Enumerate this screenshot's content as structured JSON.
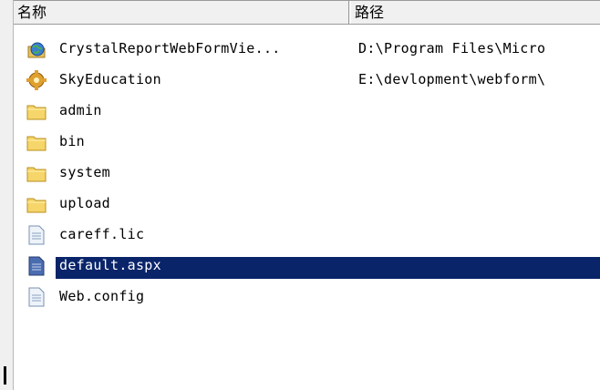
{
  "columns": {
    "name": "名称",
    "path": "路径"
  },
  "rows": [
    {
      "name": "CrystalReportWebFormVie...",
      "path": "D:\\Program Files\\Micro",
      "icon": "web-globe-icon"
    },
    {
      "name": "SkyEducation",
      "path": "E:\\devlopment\\webform\\",
      "icon": "web-gear-icon"
    },
    {
      "name": "admin",
      "path": "",
      "icon": "folder-icon"
    },
    {
      "name": "bin",
      "path": "",
      "icon": "folder-icon"
    },
    {
      "name": "system",
      "path": "",
      "icon": "folder-icon"
    },
    {
      "name": "upload",
      "path": "",
      "icon": "folder-icon"
    },
    {
      "name": "careff.lic",
      "path": "",
      "icon": "file-icon"
    },
    {
      "name": "default.aspx",
      "path": "",
      "icon": "file-icon"
    },
    {
      "name": "Web.config",
      "path": "",
      "icon": "file-icon"
    }
  ],
  "selected_row": "default.aspx",
  "colors": {
    "selection": "#0a246a",
    "folder": "#f6d56a",
    "header_bg": "#f0f0f0"
  }
}
